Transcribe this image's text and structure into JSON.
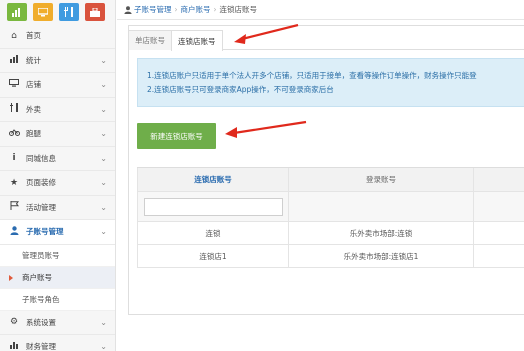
{
  "toolbar_icons": [
    {
      "name": "chart-icon",
      "color": "#7ab83f"
    },
    {
      "name": "monitor-icon",
      "color": "#f0ad2c"
    },
    {
      "name": "restaurant-icon",
      "color": "#3f9be0"
    },
    {
      "name": "shop-icon",
      "color": "#d9533d"
    }
  ],
  "sidebar": {
    "items": [
      {
        "label": "首页",
        "icon": "home-icon"
      },
      {
        "label": "统计",
        "icon": "chart-icon"
      },
      {
        "label": "店铺",
        "icon": "monitor-icon"
      },
      {
        "label": "外卖",
        "icon": "cutlery-icon"
      },
      {
        "label": "跑腿",
        "icon": "bike-icon"
      },
      {
        "label": "同城信息",
        "icon": "info-icon"
      },
      {
        "label": "页面装修",
        "icon": "star-icon"
      },
      {
        "label": "活动管理",
        "icon": "flag-icon"
      },
      {
        "label": "子账号管理",
        "icon": "user-icon"
      },
      {
        "label": "系统设置",
        "icon": "gear-icon"
      },
      {
        "label": "财务管理",
        "icon": "bar-chart-icon"
      }
    ],
    "sub_items": [
      {
        "label": "管理员账号"
      },
      {
        "label": "商户账号"
      },
      {
        "label": "子账号角色"
      }
    ]
  },
  "breadcrumb": {
    "root": "子账号管理",
    "parent": "商户账号",
    "current": "连锁店账号",
    "separator": "›"
  },
  "tabs": [
    {
      "label": "单店账号"
    },
    {
      "label": "连锁店账号"
    }
  ],
  "notice": {
    "line1": "1.连锁店账户只适用于单个法人开多个店铺，只适用于接单，查看等操作订单操作，财务操作只能登",
    "line2": "2.连锁店账号只可登录商家App操作，不可登录商家后台"
  },
  "create_button": "新建连锁店账号",
  "table": {
    "headers": [
      "连锁店账号",
      "登录账号"
    ],
    "filter_placeholder": "",
    "rows": [
      {
        "account": "连锁",
        "login": "乐外卖市场部:连锁"
      },
      {
        "account": "连锁店1",
        "login": "乐外卖市场部:连锁店1"
      }
    ]
  },
  "colors": {
    "accent": "#2b6cb0",
    "button_green": "#6fae4a",
    "notice_bg": "#dceef8",
    "arrow_red": "#e0291c"
  }
}
